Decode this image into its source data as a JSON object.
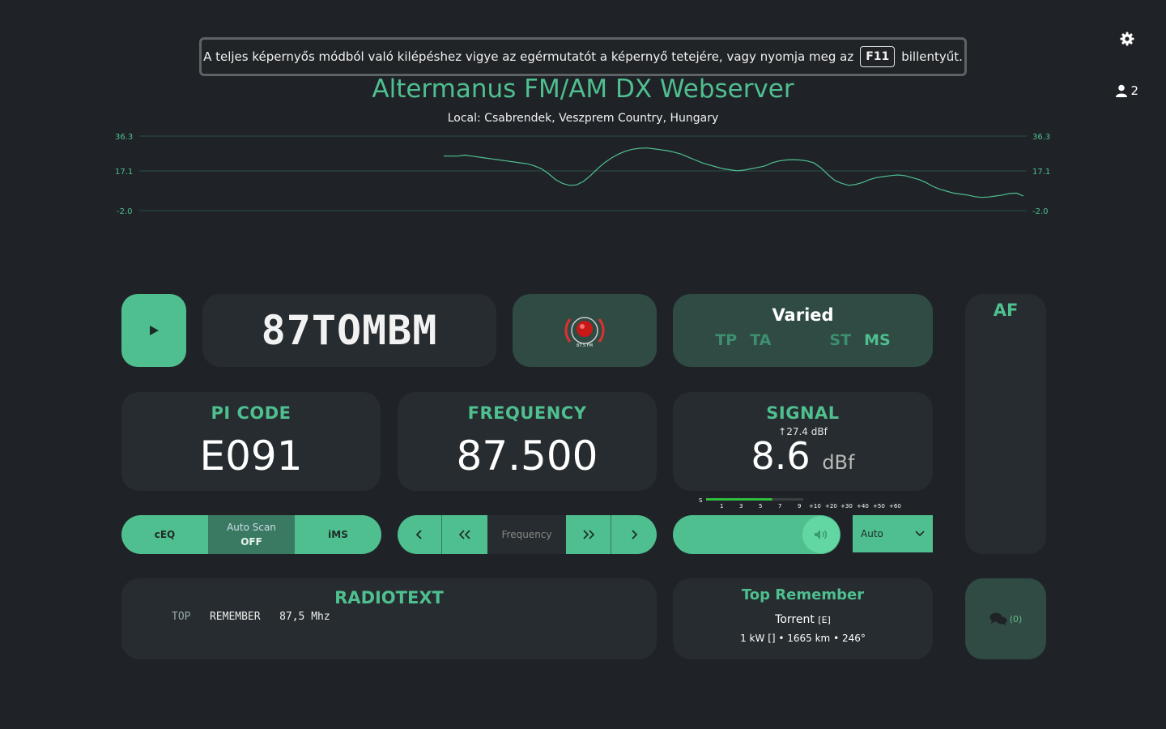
{
  "notice": {
    "text": "A teljes képernyős módból való kilépéshez vigye az egérmutatót a képernyő tetejére, vagy nyomja meg az",
    "key": "F11",
    "suffix": "billentyűt."
  },
  "header": {
    "title": "Altermanus FM/AM DX Webserver",
    "subtitle": "Local: Csabrendek, Veszprem Country, Hungary",
    "users": "2"
  },
  "chart_data": {
    "type": "line",
    "yticks": [
      "36.3",
      "17.1",
      "-2.0"
    ],
    "ylim": [
      -2.0,
      36.3
    ],
    "grid": true,
    "series": [
      {
        "values": [
          26,
          26,
          26,
          26.5,
          26,
          25.5,
          25,
          24.5,
          24,
          23.5,
          23,
          22.5,
          22,
          21,
          19.5,
          17,
          14,
          12,
          11,
          11.2,
          13,
          16,
          19.5,
          22.5,
          25,
          27,
          28.5,
          29.5,
          30,
          30.2,
          29.8,
          29.3,
          28.8,
          28,
          27,
          25.5,
          24,
          22.5,
          21.5,
          20.5,
          19.5,
          19,
          18.5,
          18.8,
          19.5,
          20.2,
          21,
          22.5,
          23.5,
          24,
          24.2,
          24,
          23.5,
          22.5,
          20,
          16.5,
          13.5,
          12,
          11,
          11.5,
          12.5,
          14,
          15,
          15.5,
          16,
          16.3,
          16,
          15,
          14,
          12.5,
          10.5,
          9,
          8,
          7,
          6.5,
          6,
          5.2,
          4.8,
          5,
          5.5,
          6,
          6.8,
          7,
          5.5
        ]
      }
    ]
  },
  "station": {
    "ps": "87TOMBM",
    "logo_text": "87.5 FM",
    "pty": "Varied",
    "flags": {
      "tp": "TP",
      "ta": "TA",
      "st": "ST",
      "ms": "MS"
    }
  },
  "af": {
    "title": "AF"
  },
  "pi": {
    "label": "PI CODE",
    "value": "E091"
  },
  "frequency": {
    "label": "FREQUENCY",
    "value": "87.500",
    "input_placeholder": "Frequency"
  },
  "signal": {
    "label": "SIGNAL",
    "peak": "27.4 dBf",
    "value": "8.6",
    "unit": "dBf",
    "level_fraction": 0.34,
    "scale": [
      "S",
      "1",
      "3",
      "5",
      "7",
      "9",
      "+10",
      "+20",
      "+30",
      "+40",
      "+50",
      "+60"
    ]
  },
  "controls": {
    "ceq": "cEQ",
    "autoscan_label": "Auto Scan",
    "autoscan_state": "OFF",
    "ims": "iMS",
    "antenna": "Auto"
  },
  "radiotext": {
    "title": "RADIOTEXT",
    "seg1": "TOP",
    "seg2": "REMEMBER",
    "seg3": "87,5 Mhz"
  },
  "transmitter": {
    "name": "Top Remember",
    "city": "Torrent",
    "itu": "[E]",
    "info": "1 kW [] • 1665 km • 246°"
  },
  "chat": {
    "count": "(0)"
  },
  "colors": {
    "accent": "#4fbf8f",
    "card": "#262c2f",
    "background": "#1f2327"
  }
}
